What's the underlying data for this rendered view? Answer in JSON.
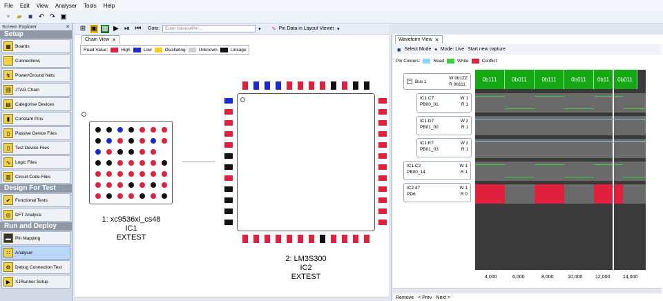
{
  "menu": [
    "File",
    "Edit",
    "View",
    "Analyser",
    "Tools",
    "Help"
  ],
  "explorer": {
    "title": "Screen Explorer",
    "sections": [
      {
        "title": "Setup",
        "items": [
          "Boards",
          "Connections",
          "Power/Ground Nets",
          "JTAG Chain",
          "Categorise Devices",
          "Constant Pins",
          "Passive Device Files",
          "Test Device Files",
          "Logic Files",
          "Circuit Code Files"
        ]
      },
      {
        "title": "Design For Test",
        "items": [
          "Functional Tests",
          "DFT Analysis"
        ]
      },
      {
        "title": "Run and Deploy",
        "items": [
          "Pin Mapping",
          "Analyser",
          "Debug Connection Test",
          "XJRunner Setup"
        ]
      }
    ],
    "selected": "Analyser"
  },
  "chain_toolbar": {
    "goto_label": "Goto:",
    "goto_placeholder": "Enter Device/Pin...",
    "pin_data_label": "Pin Data in Layout Viewer"
  },
  "chain_view": {
    "tab": "Chain View",
    "legend_title": "Read Value:",
    "legend": [
      {
        "label": "High",
        "color": "#e0203c"
      },
      {
        "label": "Low",
        "color": "#1a2ad8"
      },
      {
        "label": "Oscillating",
        "color": "#f4d21a"
      },
      {
        "label": "Unknown",
        "color": "#cfcfcf"
      },
      {
        "label": "Linkage",
        "color": "#111111"
      }
    ],
    "device1": {
      "line1": "1: xc9536xl_cs48",
      "line2": "IC1",
      "line3": "EXTEST"
    },
    "device2": {
      "line1": "2: LM3S300",
      "line2": "IC2",
      "line3": "EXTEST"
    }
  },
  "waveform": {
    "tab": "Waveform View",
    "toolbar": {
      "select_mode": "Select Mode",
      "mode": "Mode: Live",
      "capture": "Start new capture"
    },
    "pin_colours_label": "Pin Colours:",
    "pin_colours": [
      {
        "label": "Read",
        "color": "#8fd6f2"
      },
      {
        "label": "White",
        "color": "#3ad23a"
      },
      {
        "label": "Conflict",
        "color": "#e0203c"
      }
    ],
    "signals": [
      {
        "name": "Bus 1",
        "w_label": "W",
        "w_val": "0b1ZZ",
        "r_label": "R",
        "r_val": "0b111"
      },
      {
        "name": "IC1.C7",
        "name2": "PB00_01",
        "w_label": "W",
        "w_val": "1",
        "r_label": "R",
        "r_val": "1"
      },
      {
        "name": "IC1.D7",
        "name2": "PB01_00",
        "w_label": "W",
        "w_val": "z",
        "r_label": "R",
        "r_val": "1"
      },
      {
        "name": "IC1.E7",
        "name2": "PB01_03",
        "w_label": "W",
        "w_val": "z",
        "r_label": "R",
        "r_val": "1"
      },
      {
        "name": "IC1.C2",
        "name2": "PB00_14",
        "w_label": "W",
        "w_val": "1",
        "r_label": "R",
        "r_val": "1"
      },
      {
        "name": "IC2.47",
        "name2": "PD6",
        "w_label": "W",
        "w_val": "1",
        "r_label": "R",
        "r_val": "0"
      }
    ],
    "bus_values": [
      "0b111",
      "0b011",
      "0b111",
      "0b011",
      "0b11",
      "0b011"
    ],
    "ticks": [
      "4,000",
      "6,000",
      "8,000",
      "10,000",
      "12,000",
      "14,000"
    ],
    "footer": [
      "Remove",
      "< Prev",
      "Next >"
    ]
  }
}
